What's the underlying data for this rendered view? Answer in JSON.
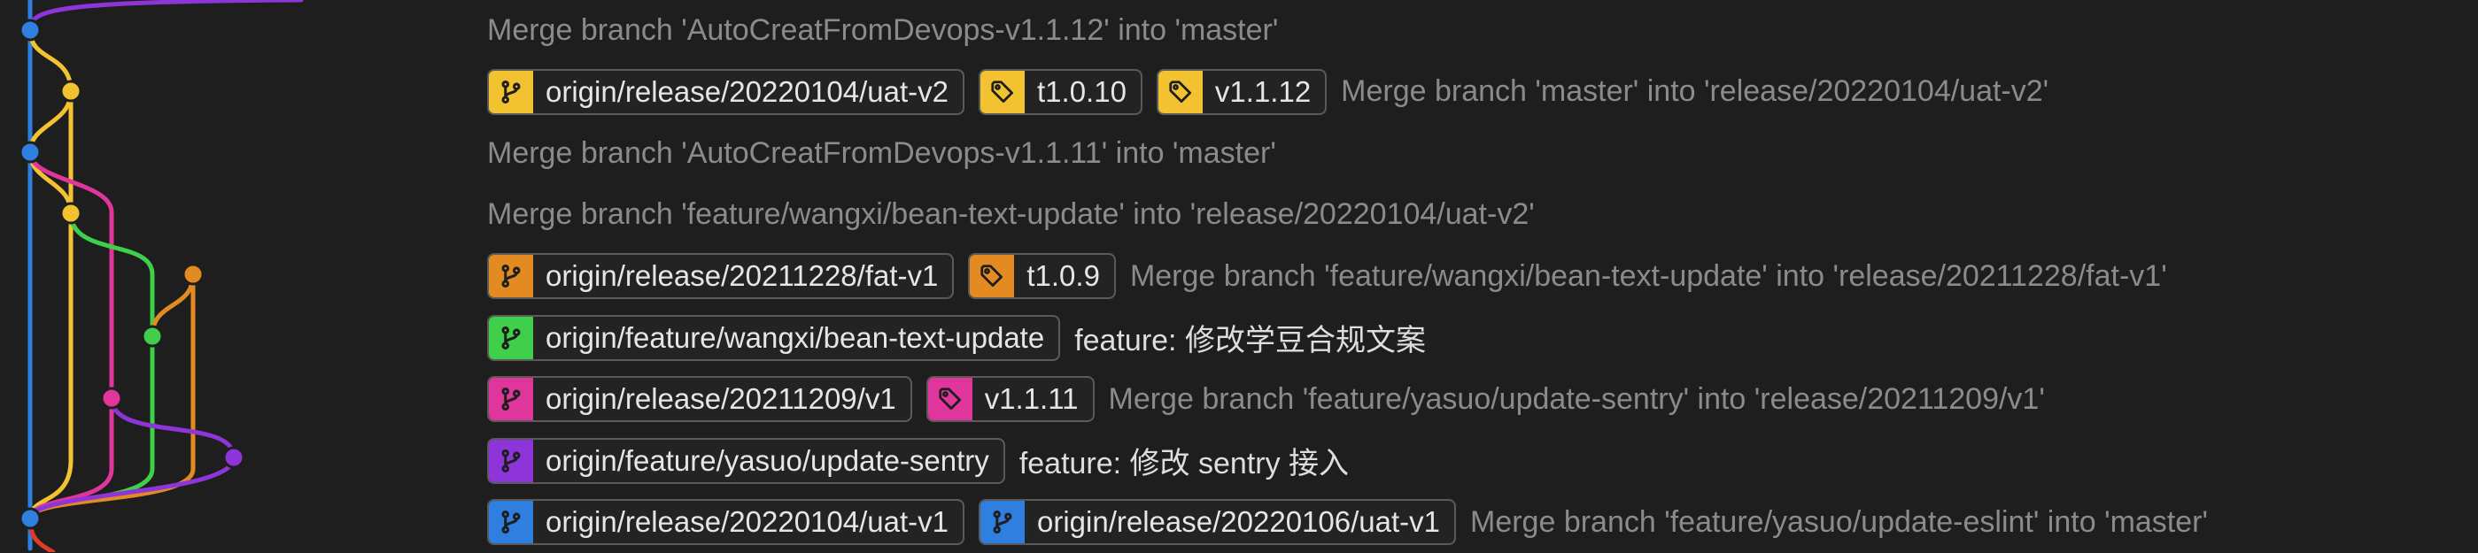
{
  "colors": {
    "blue": "#2f7fe0",
    "yellow": "#f2c230",
    "pink": "#e0359a",
    "green": "#3fcf4a",
    "orange": "#e48a22",
    "purple": "#8d35d8",
    "red": "#e23a2a",
    "branch_icon": "branch-icon",
    "tag_icon": "tag-icon"
  },
  "commits": [
    {
      "refs": [],
      "message": "Merge branch 'AutoCreatFromDevops-v1.1.12' into 'master'",
      "bright": false
    },
    {
      "refs": [
        {
          "type": "branch",
          "label": "origin/release/20220104/uat-v2",
          "color": "#f2c230"
        },
        {
          "type": "tag",
          "label": "t1.0.10",
          "color": "#f2c230"
        },
        {
          "type": "tag",
          "label": "v1.1.12",
          "color": "#f2c230"
        }
      ],
      "message": "Merge branch 'master' into 'release/20220104/uat-v2'",
      "bright": false
    },
    {
      "refs": [],
      "message": "Merge branch 'AutoCreatFromDevops-v1.1.11' into 'master'",
      "bright": false
    },
    {
      "refs": [],
      "message": "Merge branch 'feature/wangxi/bean-text-update' into 'release/20220104/uat-v2'",
      "bright": false
    },
    {
      "refs": [
        {
          "type": "branch",
          "label": "origin/release/20211228/fat-v1",
          "color": "#e48a22"
        },
        {
          "type": "tag",
          "label": "t1.0.9",
          "color": "#e48a22"
        }
      ],
      "message": "Merge branch 'feature/wangxi/bean-text-update' into 'release/20211228/fat-v1'",
      "bright": false
    },
    {
      "refs": [
        {
          "type": "branch",
          "label": "origin/feature/wangxi/bean-text-update",
          "color": "#3fcf4a"
        }
      ],
      "message": "feature: 修改学豆合规文案",
      "bright": true
    },
    {
      "refs": [
        {
          "type": "branch",
          "label": "origin/release/20211209/v1",
          "color": "#e0359a"
        },
        {
          "type": "tag",
          "label": "v1.1.11",
          "color": "#e0359a"
        }
      ],
      "message": "Merge branch 'feature/yasuo/update-sentry' into 'release/20211209/v1'",
      "bright": false
    },
    {
      "refs": [
        {
          "type": "branch",
          "label": "origin/feature/yasuo/update-sentry",
          "color": "#8d35d8"
        }
      ],
      "message": "feature: 修改 sentry 接入",
      "bright": true
    },
    {
      "refs": [
        {
          "type": "branch",
          "label": "origin/release/20220104/uat-v1",
          "color": "#2f7fe0"
        },
        {
          "type": "branch",
          "label": "origin/release/20220106/uat-v1",
          "color": "#2f7fe0"
        }
      ],
      "message": "Merge branch 'feature/yasuo/update-eslint' into 'master'",
      "bright": false
    }
  ]
}
